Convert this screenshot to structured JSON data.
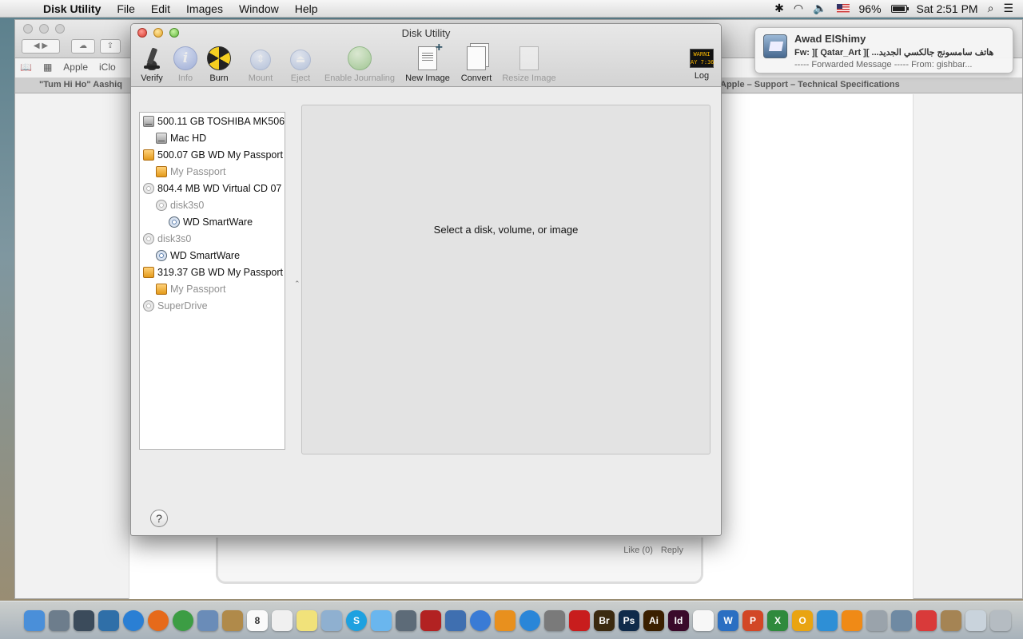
{
  "menubar": {
    "app_name": "Disk Utility",
    "menus": [
      "File",
      "Edit",
      "Images",
      "Window",
      "Help"
    ],
    "battery_percent": "96%",
    "battery_level": 0.96,
    "clock": "Sat 2:51 PM",
    "icons": [
      "apple-icon",
      "bluetooth-icon",
      "wifi-icon",
      "volume-icon",
      "flag-icon",
      "battery-icon",
      "spotlight-icon",
      "notification-center-icon"
    ]
  },
  "safari": {
    "bookmarks": [
      "Apple",
      "iClo"
    ],
    "tab_left": "\"Tum Hi Ho\" Aashiq",
    "tab_right": "Apple – Support – Technical Specifications",
    "comment_like": "Like (0)",
    "comment_reply": "Reply"
  },
  "notification": {
    "sender": "Awad ElShimy",
    "subject": "Fw: ][ Qatar_Art ][ ...هاتف سامسونج جالكسي الجديد",
    "body": "----- Forwarded Message ----- From: gishbar..."
  },
  "disk_utility": {
    "title": "Disk Utility",
    "toolbar": [
      {
        "id": "verify",
        "label": "Verify",
        "enabled": true
      },
      {
        "id": "info",
        "label": "Info",
        "enabled": false
      },
      {
        "id": "burn",
        "label": "Burn",
        "enabled": true
      },
      {
        "id": "mount",
        "label": "Mount",
        "enabled": false
      },
      {
        "id": "eject",
        "label": "Eject",
        "enabled": false
      },
      {
        "id": "journal",
        "label": "Enable Journaling",
        "enabled": false
      },
      {
        "id": "newimage",
        "label": "New Image",
        "enabled": true
      },
      {
        "id": "convert",
        "label": "Convert",
        "enabled": true
      },
      {
        "id": "resize",
        "label": "Resize Image",
        "enabled": false
      },
      {
        "id": "log",
        "label": "Log",
        "enabled": true
      }
    ],
    "log_icon_text": "WARNI\nAY 7:36",
    "disks": [
      {
        "label": "500.11 GB TOSHIBA MK506",
        "icon": "hard-disk-icon",
        "level": 0,
        "dim": false
      },
      {
        "label": "Mac HD",
        "icon": "hard-disk-icon",
        "level": 1,
        "dim": false
      },
      {
        "label": "500.07 GB WD My Passport",
        "icon": "external-drive-icon",
        "level": 0,
        "dim": false
      },
      {
        "label": "My Passport",
        "icon": "external-drive-icon",
        "level": 1,
        "dim": true
      },
      {
        "label": "804.4 MB WD Virtual CD 07",
        "icon": "optical-disc-icon",
        "level": 0,
        "dim": false
      },
      {
        "label": "disk3s0",
        "icon": "optical-disc-icon",
        "level": 1,
        "dim": true
      },
      {
        "label": "WD SmartWare",
        "icon": "disc-volume-icon",
        "level": 2,
        "dim": false
      },
      {
        "label": "disk3s0",
        "icon": "optical-disc-icon",
        "level": 0,
        "dim": true
      },
      {
        "label": "WD SmartWare",
        "icon": "disc-volume-icon",
        "level": 1,
        "dim": false
      },
      {
        "label": "319.37 GB WD My Passport",
        "icon": "external-drive-icon",
        "level": 0,
        "dim": false
      },
      {
        "label": "My Passport",
        "icon": "external-drive-icon",
        "level": 1,
        "dim": true
      },
      {
        "label": "SuperDrive",
        "icon": "optical-disc-icon",
        "level": 0,
        "dim": true
      }
    ],
    "placeholder": "Select a disk, volume, or image",
    "help_label": "?"
  },
  "dock": {
    "apps": [
      {
        "name": "finder",
        "color": "#4a8fd9",
        "glyph": ""
      },
      {
        "name": "launchpad",
        "color": "#6d7d8c",
        "glyph": ""
      },
      {
        "name": "mission-control",
        "color": "#3b4b5b",
        "glyph": ""
      },
      {
        "name": "dashboard",
        "color": "#2f6fa8",
        "glyph": ""
      },
      {
        "name": "safari",
        "color": "#2a7fd4",
        "glyph": ""
      },
      {
        "name": "firefox",
        "color": "#e66a1a",
        "glyph": ""
      },
      {
        "name": "chrome",
        "color": "#3c9d44",
        "glyph": ""
      },
      {
        "name": "mail",
        "color": "#6a8cb8",
        "glyph": ""
      },
      {
        "name": "contacts",
        "color": "#b08a4a",
        "glyph": ""
      },
      {
        "name": "calendar",
        "color": "#fafafa",
        "glyph": "8"
      },
      {
        "name": "reminders",
        "color": "#f0f0f0",
        "glyph": ""
      },
      {
        "name": "stickies",
        "color": "#f1e27a",
        "glyph": ""
      },
      {
        "name": "preview",
        "color": "#8fb0d0",
        "glyph": ""
      },
      {
        "name": "skype",
        "color": "#1ea1e0",
        "glyph": "S"
      },
      {
        "name": "messages",
        "color": "#6ab6ee",
        "glyph": ""
      },
      {
        "name": "facetime",
        "color": "#5d6b78",
        "glyph": ""
      },
      {
        "name": "photo-booth",
        "color": "#b22222",
        "glyph": ""
      },
      {
        "name": "utility",
        "color": "#3f6fb0",
        "glyph": ""
      },
      {
        "name": "itunes",
        "color": "#3a7bd5",
        "glyph": ""
      },
      {
        "name": "ibooks",
        "color": "#e8901e",
        "glyph": ""
      },
      {
        "name": "app-store",
        "color": "#2a86d8",
        "glyph": ""
      },
      {
        "name": "system-preferences",
        "color": "#7a7a7a",
        "glyph": ""
      },
      {
        "name": "acrobat",
        "color": "#c81d1d",
        "glyph": ""
      },
      {
        "name": "bridge",
        "color": "#3b2a10",
        "glyph": "Br"
      },
      {
        "name": "photoshop",
        "color": "#0f2a4a",
        "glyph": "Ps"
      },
      {
        "name": "illustrator",
        "color": "#3a1f00",
        "glyph": "Ai"
      },
      {
        "name": "indesign",
        "color": "#3a0a2a",
        "glyph": "Id"
      },
      {
        "name": "textedit",
        "color": "#f7f7f7",
        "glyph": ""
      },
      {
        "name": "word",
        "color": "#2b6fc2",
        "glyph": "W"
      },
      {
        "name": "powerpoint",
        "color": "#d24726",
        "glyph": "P"
      },
      {
        "name": "excel",
        "color": "#2f8a3d",
        "glyph": "X"
      },
      {
        "name": "outlook",
        "color": "#e9a412",
        "glyph": "O"
      },
      {
        "name": "lync",
        "color": "#2e8fd6",
        "glyph": ""
      },
      {
        "name": "vlc",
        "color": "#f08a16",
        "glyph": ""
      },
      {
        "name": "disk-utility",
        "color": "#9aa3ab",
        "glyph": ""
      },
      {
        "name": "iphoto",
        "color": "#6f8aa3",
        "glyph": ""
      },
      {
        "name": "flashcard",
        "color": "#d93a3a",
        "glyph": ""
      },
      {
        "name": "document-folder",
        "color": "#a58454",
        "glyph": ""
      },
      {
        "name": "downloads",
        "color": "#c9d3dc",
        "glyph": ""
      },
      {
        "name": "trash",
        "color": "#b5bcc2",
        "glyph": ""
      }
    ]
  }
}
